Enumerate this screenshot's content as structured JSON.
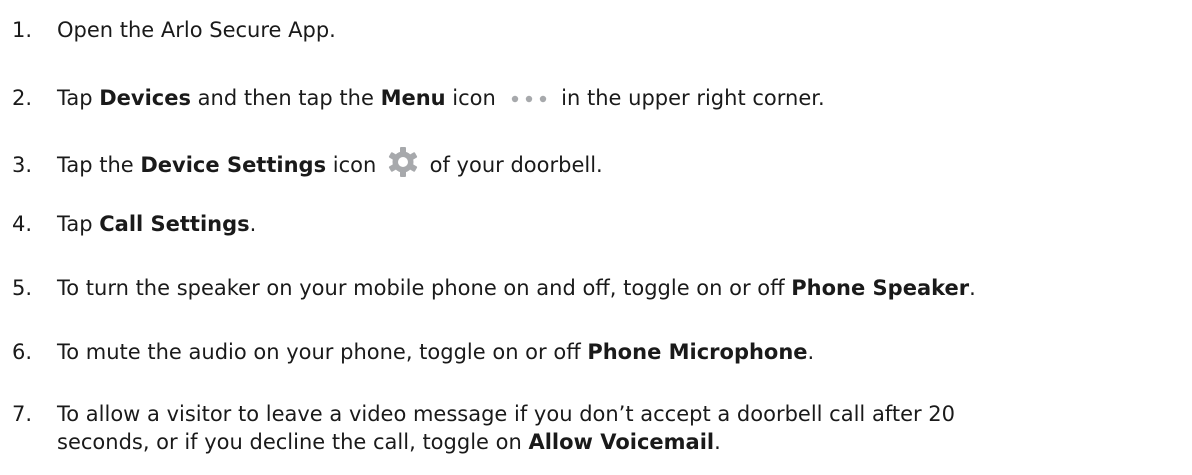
{
  "steps": [
    {
      "num": "1.",
      "text1": "Open the Arlo Secure App."
    },
    {
      "num": "2.",
      "t1": "Tap ",
      "b1": "Devices",
      "t2": " and then tap the ",
      "b2": "Menu",
      "t3": " icon ",
      "t4": " in the  upper right corner.",
      "icon": "menu-dots-icon"
    },
    {
      "num": "3.",
      "t1": "Tap the ",
      "b1": "Device Settings",
      "t2": " icon ",
      "t3": " of your doorbell.",
      "icon": "gear-icon"
    },
    {
      "num": "4.",
      "t1": "Tap ",
      "b1": "Call Settings",
      "t2": "."
    },
    {
      "num": "5.",
      "t1": "To turn the speaker on your mobile phone on and off, toggle on or off ",
      "b1": "Phone Speaker",
      "t2": "."
    },
    {
      "num": "6.",
      "t1": "To mute the audio on your phone, toggle on or off ",
      "b1": "Phone Microphone",
      "t2": "."
    },
    {
      "num": "7.",
      "t1": "To allow a visitor to leave a video message if you don’t accept a doorbell call after 20",
      "t2": "seconds, or if you decline the call, toggle on ",
      "b1": "Allow Voicemail",
      "t3": "."
    }
  ],
  "colors": {
    "text": "#1a1a1a",
    "icon_gray": "#a7a9ac"
  }
}
